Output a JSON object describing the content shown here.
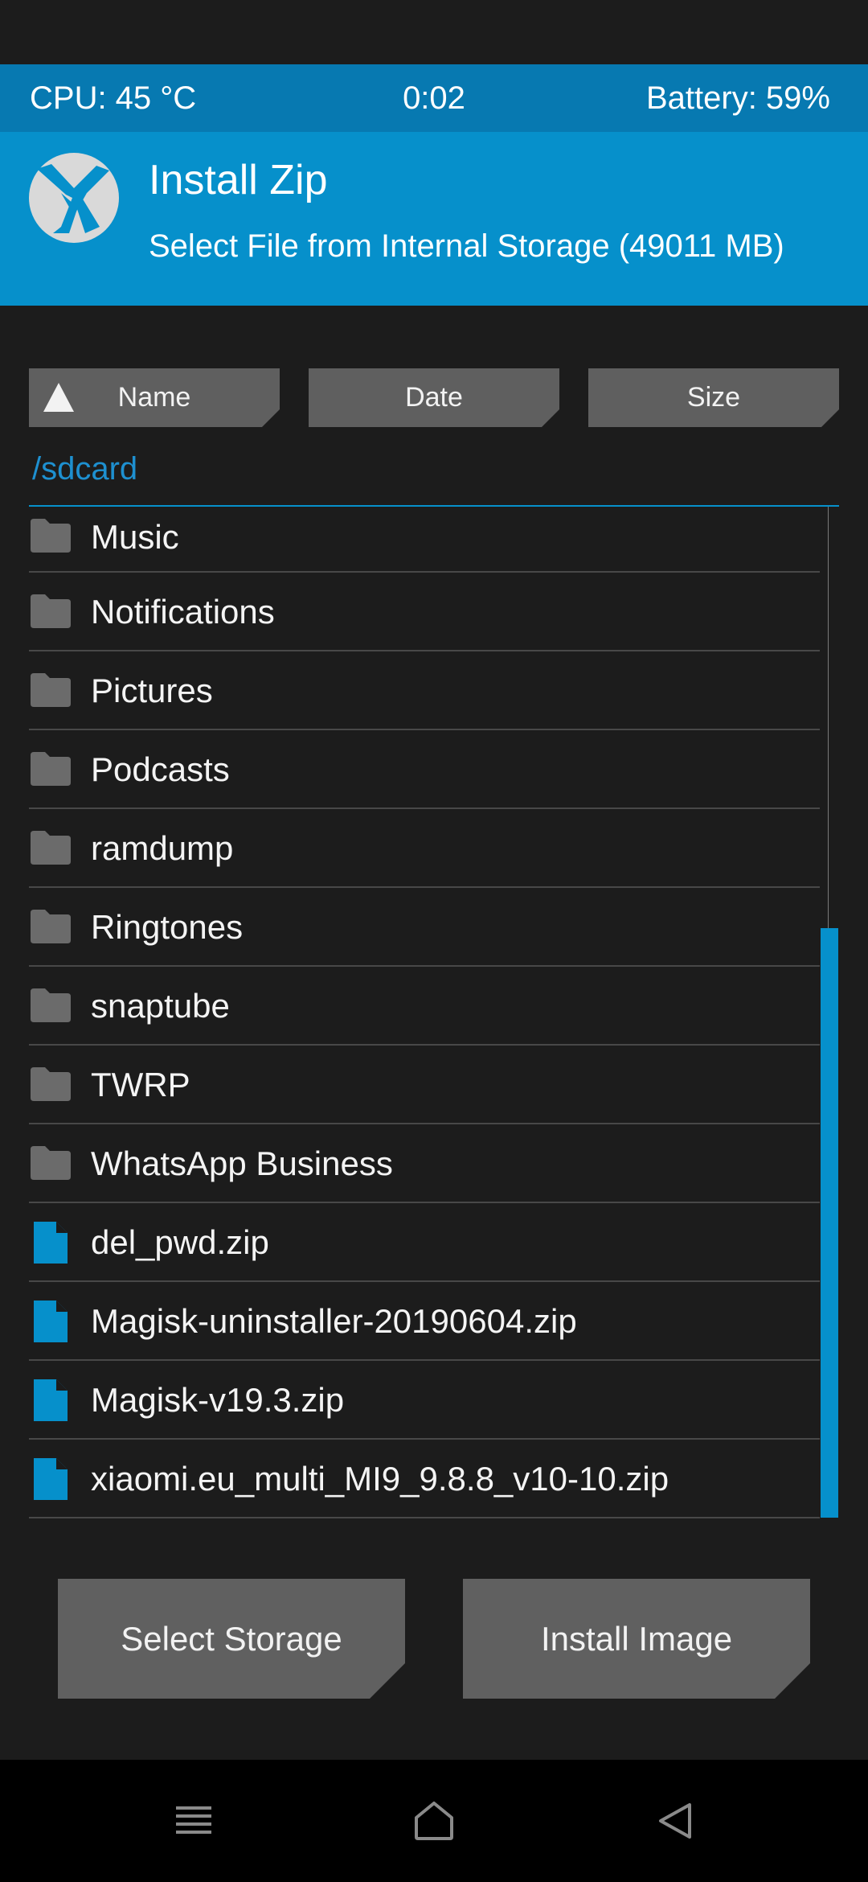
{
  "status": {
    "cpu": "CPU: 45 °C",
    "clock": "0:02",
    "battery": "Battery: 59%"
  },
  "header": {
    "title": "Install Zip",
    "subtitle": "Select File from Internal Storage (49011 MB)"
  },
  "sort": {
    "name": "Name",
    "date": "Date",
    "size": "Size"
  },
  "path": "/sdcard",
  "files": [
    {
      "name": "Music",
      "type": "folder"
    },
    {
      "name": "Notifications",
      "type": "folder"
    },
    {
      "name": "Pictures",
      "type": "folder"
    },
    {
      "name": "Podcasts",
      "type": "folder"
    },
    {
      "name": "ramdump",
      "type": "folder"
    },
    {
      "name": "Ringtones",
      "type": "folder"
    },
    {
      "name": "snaptube",
      "type": "folder"
    },
    {
      "name": "TWRP",
      "type": "folder"
    },
    {
      "name": "WhatsApp Business",
      "type": "folder"
    },
    {
      "name": "del_pwd.zip",
      "type": "zip"
    },
    {
      "name": "Magisk-uninstaller-20190604.zip",
      "type": "zip"
    },
    {
      "name": "Magisk-v19.3.zip",
      "type": "zip"
    },
    {
      "name": "xiaomi.eu_multi_MI9_9.8.8_v10-10.zip",
      "type": "zip"
    }
  ],
  "buttons": {
    "select_storage": "Select Storage",
    "install_image": "Install Image"
  },
  "nav": {
    "menu_icon": "menu-icon",
    "home_icon": "home-icon",
    "back_icon": "back-icon"
  },
  "colors": {
    "accent": "#0690cb",
    "status_bar": "#0779b1",
    "background": "#1c1c1c",
    "button": "#5f5f5f"
  }
}
